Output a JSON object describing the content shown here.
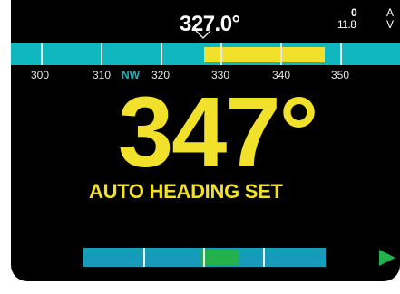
{
  "header": {
    "current_heading": "327.0°",
    "top_right_value_1": "0",
    "top_right_value_2": "11.8",
    "top_right_unit_1": "A",
    "top_right_unit_2": "V"
  },
  "heading_scale": {
    "ticks": [
      "300",
      "310",
      "320",
      "330",
      "340",
      "350"
    ],
    "compass_direction": "NW"
  },
  "main": {
    "set_heading": "347°",
    "mode_label": "AUTO HEADING SET"
  },
  "colors": {
    "accent_yellow": "#f2e12b",
    "scale_cyan": "#0fb8be",
    "rudder_blue": "#159cba",
    "rudder_green": "#22b14c"
  },
  "icons": {
    "caret": "caret-down-icon",
    "play": "play-icon"
  }
}
